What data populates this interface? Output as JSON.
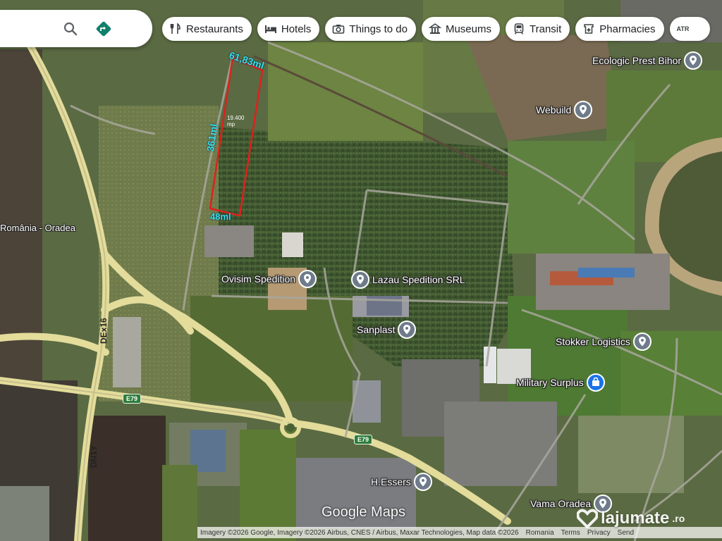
{
  "search": {
    "placeholder": ""
  },
  "chips": [
    {
      "label": "Restaurants",
      "icon": "fork-knife-icon"
    },
    {
      "label": "Hotels",
      "icon": "bed-icon"
    },
    {
      "label": "Things to do",
      "icon": "camera-icon"
    },
    {
      "label": "Museums",
      "icon": "museum-icon"
    },
    {
      "label": "Transit",
      "icon": "train-icon"
    },
    {
      "label": "Pharmacies",
      "icon": "pharmacy-icon"
    },
    {
      "label": "ATR",
      "icon": "atm-icon",
      "partial": true
    }
  ],
  "places": {
    "ecologic": "Ecologic Prest Bihor",
    "webuild": "Webuild",
    "ovisim": "Ovisim Spedition",
    "lazau": "Lazau Spedition SRL",
    "sanplast": "Sanplast",
    "stokker": "Stokker Logistics",
    "military": "Military Surplus",
    "essers": "H.Essers",
    "vama": "Vama Oradea"
  },
  "map_text": {
    "romania_oradea": "România - Oradea"
  },
  "roads": {
    "dex16": "DEx16",
    "dn1y": "DN1Y",
    "e79_a": "E79",
    "e79_b": "E79"
  },
  "measurements": {
    "top": "61,83ml",
    "side": "361ml",
    "bottom": "48ml",
    "area_line1": "19.400",
    "area_line2": "mp"
  },
  "logo": {
    "part1": "Google",
    "part2": " Maps"
  },
  "attribution": {
    "imagery": "Imagery ©2026 Google, Imagery ©2026 Airbus, CNES / Airbus, Maxar Technologies, Map data ©2026",
    "country": "Romania",
    "terms": "Terms",
    "privacy": "Privacy",
    "feedback": "Send"
  },
  "watermark": {
    "name": "lajumate",
    "tld": ".ro"
  },
  "colors": {
    "pin_gray": "#6e7b8a",
    "pin_blue": "#1a73e8",
    "directions_teal": "#11806a",
    "measure_cyan": "#34e0e6",
    "parcel_red": "#e0201c"
  }
}
